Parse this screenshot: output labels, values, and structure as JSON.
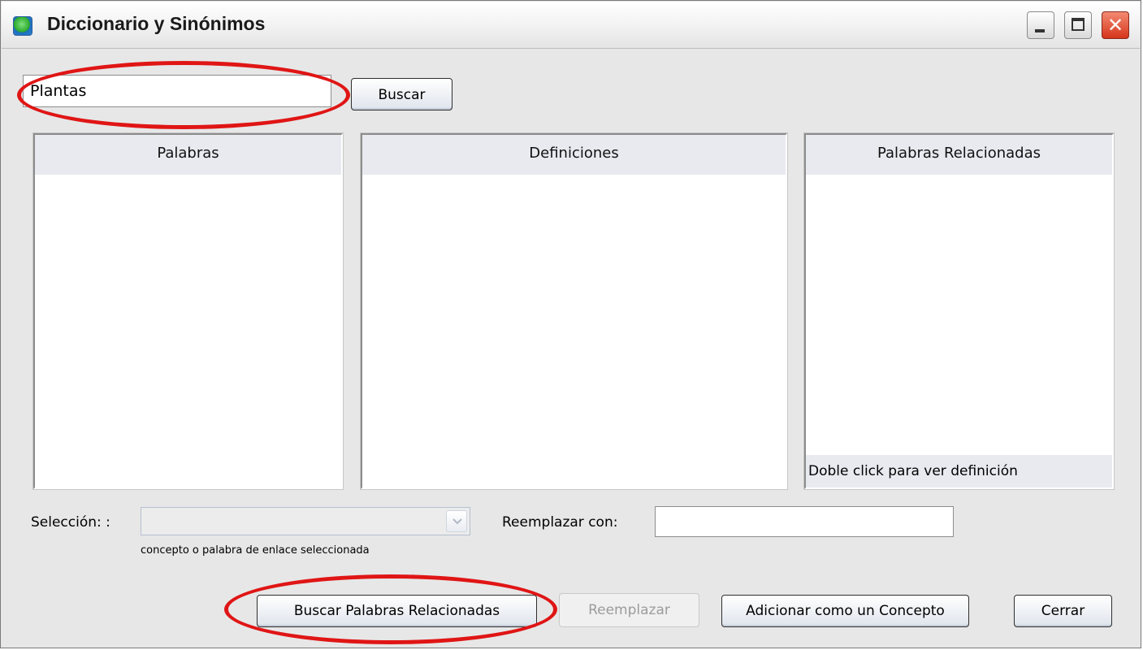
{
  "window": {
    "title": "Diccionario y Sinónimos",
    "icons": {
      "app": "dictionary-app-icon",
      "minimize": "minimize-icon",
      "maximize": "maximize-icon",
      "close": "close-icon"
    },
    "close_glyph": "✕"
  },
  "search": {
    "value": "Plantas",
    "button_label": "Buscar"
  },
  "panels": {
    "words": {
      "header": "Palabras"
    },
    "definitions": {
      "header": "Definiciones"
    },
    "related": {
      "header": "Palabras Relacionadas",
      "hint": "Doble click para ver definición"
    }
  },
  "selection": {
    "label": "Selección: :",
    "value": "",
    "caption": "concepto o palabra de  enlace seleccionada"
  },
  "replace": {
    "label": "Reemplazar con:",
    "value": ""
  },
  "buttons": {
    "find_related": "Buscar Palabras Relacionadas",
    "replace": "Reemplazar",
    "add_concept": "Adicionar como un Concepto",
    "close": "Cerrar"
  },
  "annotations": {
    "highlight_color": "#e01515"
  }
}
